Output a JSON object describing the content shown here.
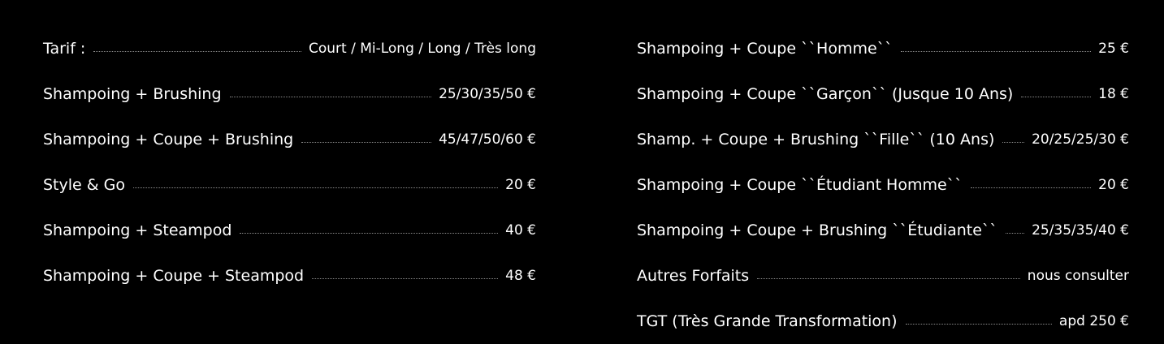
{
  "left_column": [
    {
      "name": "Tarif :",
      "price": "Court / Mi-Long / Long / Très long"
    },
    {
      "name": "Shampoing + Brushing",
      "price": "25/30/35/50 €"
    },
    {
      "name": "Shampoing + Coupe + Brushing",
      "price": "45/47/50/60 €"
    },
    {
      "name": "Style & Go",
      "price": "20 €"
    },
    {
      "name": "Shampoing + Steampod",
      "price": "40 €"
    },
    {
      "name": "Shampoing + Coupe + Steampod",
      "price": "48 €"
    }
  ],
  "right_column": [
    {
      "name": "Shampoing + Coupe ``Homme``",
      "price": "25 €"
    },
    {
      "name": "Shampoing + Coupe ``Garçon`` (Jusque 10 Ans)",
      "price": "18 €"
    },
    {
      "name": "Shamp. + Coupe + Brushing ``Fille`` (10 Ans)",
      "price": "20/25/25/30 €"
    },
    {
      "name": "Shampoing + Coupe ``Étudiant Homme``",
      "price": "20 €"
    },
    {
      "name": "Shampoing + Coupe + Brushing ``Étudiante``",
      "price": "25/35/35/40 €"
    },
    {
      "name": "Autres Forfaits",
      "price": "nous consulter"
    },
    {
      "name": "TGT (Très Grande Transformation)",
      "price": "apd 250 €"
    }
  ]
}
